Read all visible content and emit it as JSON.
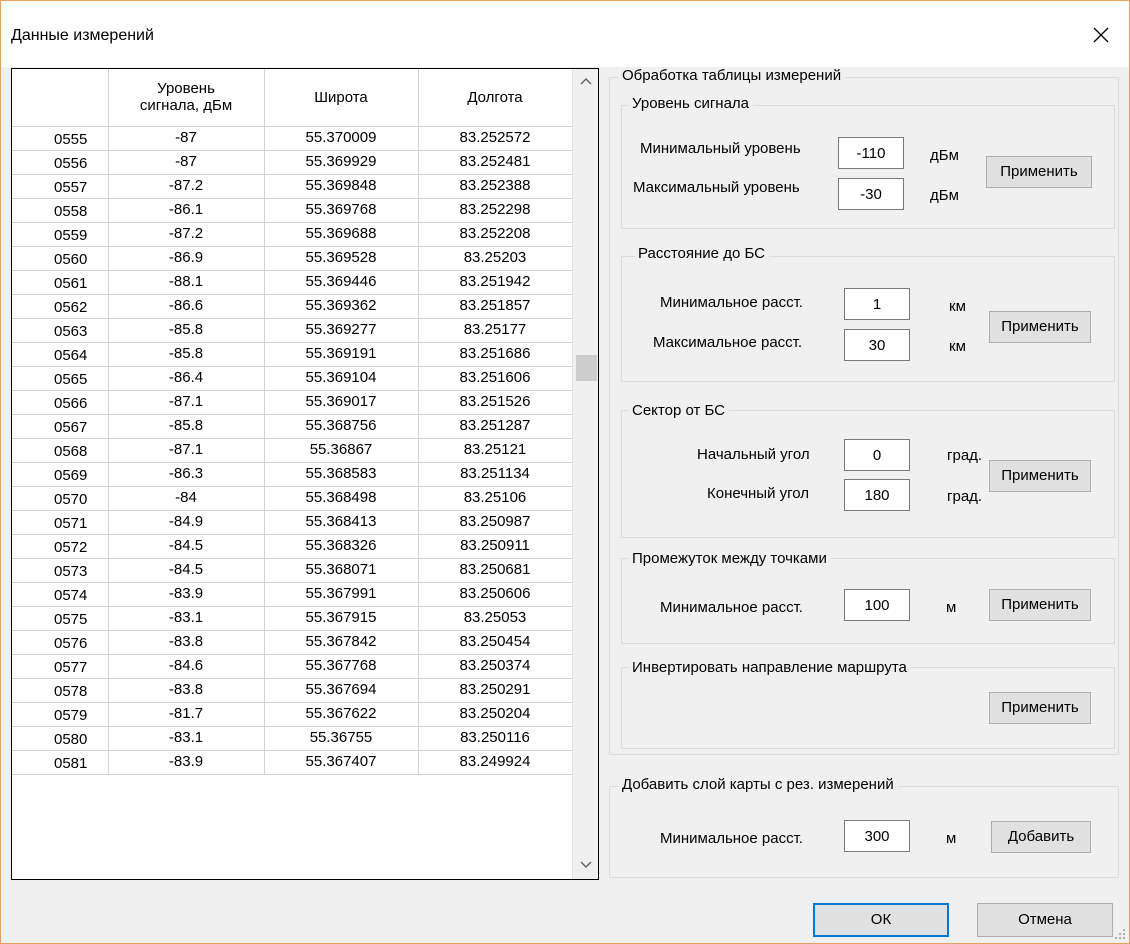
{
  "window": {
    "title": "Данные измерений"
  },
  "grid": {
    "headers": [
      "",
      "Уровень сигнала, дБм",
      "Широта",
      "Долгота"
    ],
    "rows": [
      [
        "0555",
        "-87",
        "55.370009",
        "83.252572"
      ],
      [
        "0556",
        "-87",
        "55.369929",
        "83.252481"
      ],
      [
        "0557",
        "-87.2",
        "55.369848",
        "83.252388"
      ],
      [
        "0558",
        "-86.1",
        "55.369768",
        "83.252298"
      ],
      [
        "0559",
        "-87.2",
        "55.369688",
        "83.252208"
      ],
      [
        "0560",
        "-86.9",
        "55.369528",
        "83.25203"
      ],
      [
        "0561",
        "-88.1",
        "55.369446",
        "83.251942"
      ],
      [
        "0562",
        "-86.6",
        "55.369362",
        "83.251857"
      ],
      [
        "0563",
        "-85.8",
        "55.369277",
        "83.25177"
      ],
      [
        "0564",
        "-85.8",
        "55.369191",
        "83.251686"
      ],
      [
        "0565",
        "-86.4",
        "55.369104",
        "83.251606"
      ],
      [
        "0566",
        "-87.1",
        "55.369017",
        "83.251526"
      ],
      [
        "0567",
        "-85.8",
        "55.368756",
        "83.251287"
      ],
      [
        "0568",
        "-87.1",
        "55.36867",
        "83.25121"
      ],
      [
        "0569",
        "-86.3",
        "55.368583",
        "83.251134"
      ],
      [
        "0570",
        "-84",
        "55.368498",
        "83.25106"
      ],
      [
        "0571",
        "-84.9",
        "55.368413",
        "83.250987"
      ],
      [
        "0572",
        "-84.5",
        "55.368326",
        "83.250911"
      ],
      [
        "0573",
        "-84.5",
        "55.368071",
        "83.250681"
      ],
      [
        "0574",
        "-83.9",
        "55.367991",
        "83.250606"
      ],
      [
        "0575",
        "-83.1",
        "55.367915",
        "83.25053"
      ],
      [
        "0576",
        "-83.8",
        "55.367842",
        "83.250454"
      ],
      [
        "0577",
        "-84.6",
        "55.367768",
        "83.250374"
      ],
      [
        "0578",
        "-83.8",
        "55.367694",
        "83.250291"
      ],
      [
        "0579",
        "-81.7",
        "55.367622",
        "83.250204"
      ],
      [
        "0580",
        "-83.1",
        "55.36755",
        "83.250116"
      ],
      [
        "0581",
        "-83.9",
        "55.367407",
        "83.249924"
      ]
    ],
    "scroll_up_icon": "chevron-up-icon",
    "scroll_down_icon": "chevron-down-icon"
  },
  "processing": {
    "title": "Обработка таблицы измерений",
    "signal": {
      "title": "Уровень сигнала",
      "min_label": "Минимальный уровень",
      "min_value": "-110",
      "min_unit": "дБм",
      "max_label": "Максимальный уровень",
      "max_value": "-30",
      "max_unit": "дБм",
      "apply": "Применить"
    },
    "distance": {
      "title": "Расстояние до БС",
      "min_label": "Минимальное расст.",
      "min_value": "1",
      "min_unit": "км",
      "max_label": "Максимальное расст.",
      "max_value": "30",
      "max_unit": "км",
      "apply": "Применить"
    },
    "sector": {
      "title": "Сектор от БС",
      "start_label": "Начальный угол",
      "start_value": "0",
      "start_unit": "град.",
      "end_label": "Конечный угол",
      "end_value": "180",
      "end_unit": "град.",
      "apply": "Применить"
    },
    "interval": {
      "title": "Промежуток между точками",
      "min_label": "Минимальное расст.",
      "min_value": "100",
      "min_unit": "м",
      "apply": "Применить"
    },
    "invert": {
      "title": "Инвертировать направление маршрута",
      "apply": "Применить"
    }
  },
  "layer": {
    "title": "Добавить слой карты с рез. измерений",
    "min_label": "Минимальное расст.",
    "min_value": "300",
    "min_unit": "м",
    "add": "Добавить"
  },
  "footer": {
    "ok": "ОК",
    "cancel": "Отмена"
  }
}
